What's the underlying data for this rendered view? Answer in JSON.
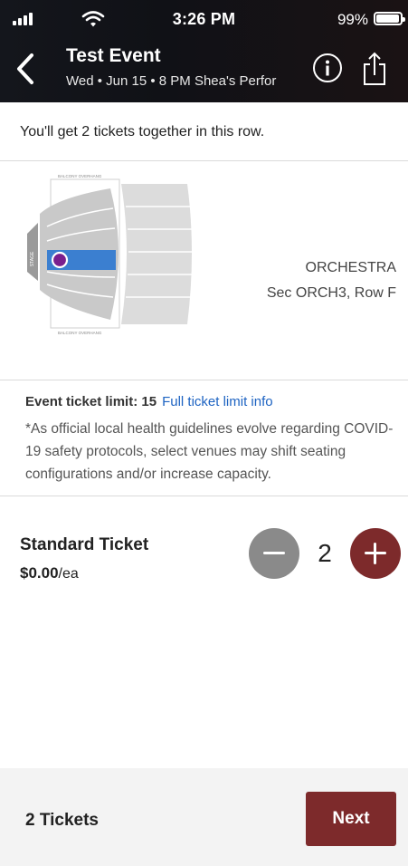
{
  "status_bar": {
    "time": "3:26 PM",
    "battery_percent": "99%",
    "battery_level": 0.99,
    "icons": [
      "signal-icon",
      "wifi-icon",
      "battery-icon"
    ]
  },
  "header": {
    "back_icon": "chevron-left-icon",
    "title": "Test Event",
    "subtitle": "Wed • Jun 15 • 8 PM Shea's Perfor",
    "info_icon": "info-icon",
    "share_icon": "share-icon"
  },
  "seat_info": {
    "together_text": "You'll get 2 tickets together in this row.",
    "map_labels": {
      "balcony_top": "BALCONY OVERHANG",
      "balcony_bottom": "BALCONY OVERHANG",
      "stage": "STAGE"
    },
    "section": "ORCHESTRA",
    "section_row": "Sec ORCH3, Row F"
  },
  "limits": {
    "label": "Event ticket limit: 15",
    "link": "Full ticket limit info",
    "notice": "*As official local health guidelines evolve regarding COVID-19 safety protocols, select venues may shift seating configurations and/or increase capacity."
  },
  "ticket": {
    "name": "Standard Ticket",
    "price": "$0.00",
    "price_unit": "/ea",
    "quantity": "2",
    "minus_icon": "minus-icon",
    "plus_icon": "plus-icon"
  },
  "footer": {
    "count": "2 Tickets",
    "next_label": "Next"
  },
  "colors": {
    "brand": "#7d2a2b",
    "link": "#1d63c2",
    "selected_row": "#3b7fd0",
    "seat_marker": "#7a1f8e",
    "stepper_disabled": "#8a8a8a"
  }
}
